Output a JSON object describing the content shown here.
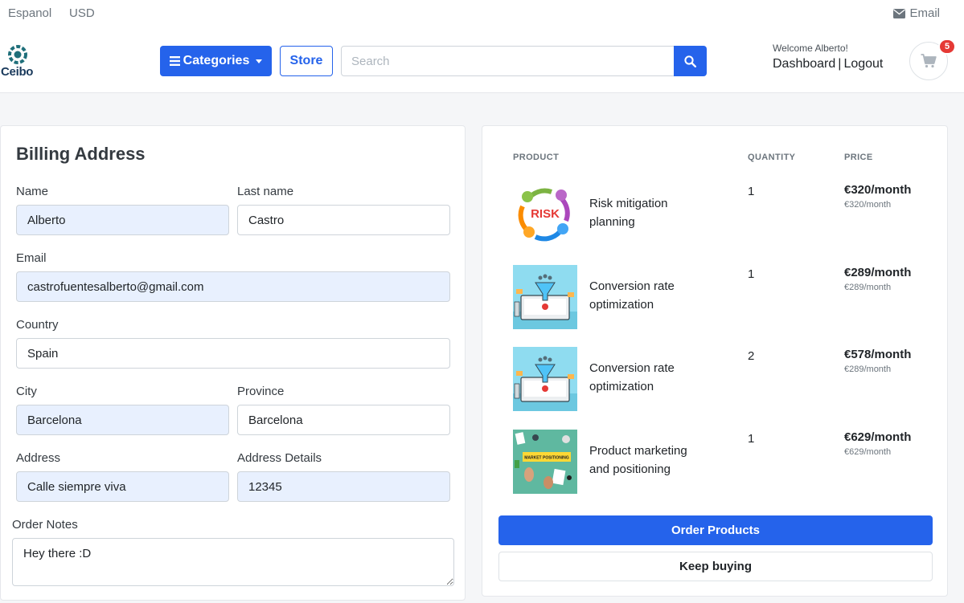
{
  "topbar": {
    "language": "Espanol",
    "currency": "USD",
    "email_label": "Email"
  },
  "header": {
    "logo_text": "Ceibo",
    "categories_label": "Categories",
    "store_label": "Store",
    "search_placeholder": "Search",
    "welcome": "Welcome Alberto!",
    "dashboard_label": "Dashboard",
    "separator": "|",
    "logout_label": "Logout",
    "cart_count": "5"
  },
  "billing": {
    "title": "Billing Address",
    "name_label": "Name",
    "name_value": "Alberto",
    "lastname_label": "Last name",
    "lastname_value": "Castro",
    "email_label": "Email",
    "email_value": "castrofuentesalberto@gmail.com",
    "country_label": "Country",
    "country_value": "Spain",
    "city_label": "City",
    "city_value": "Barcelona",
    "province_label": "Province",
    "province_value": "Barcelona",
    "address_label": "Address",
    "address_value": "Calle siempre viva",
    "address_details_label": "Address Details",
    "address_details_value": "12345",
    "notes_label": "Order Notes",
    "notes_value": "Hey there :D"
  },
  "order": {
    "col_product": "PRODUCT",
    "col_quantity": "QUANTITY",
    "col_price": "PRICE",
    "items": [
      {
        "name": "Risk mitigation planning",
        "quantity": "1",
        "total": "€320/month",
        "unit": "€320/month",
        "image": "risk-image"
      },
      {
        "name": "Conversion rate optimization",
        "quantity": "1",
        "total": "€289/month",
        "unit": "€289/month",
        "image": "conversion-image"
      },
      {
        "name": "Conversion rate optimization",
        "quantity": "2",
        "total": "€578/month",
        "unit": "€289/month",
        "image": "conversion-image"
      },
      {
        "name": "Product marketing and positioning",
        "quantity": "1",
        "total": "€629/month",
        "unit": "€629/month",
        "image": "marketing-image"
      }
    ],
    "order_button": "Order Products",
    "keep_button": "Keep buying"
  },
  "image_text": {
    "risk_word": "RISK",
    "market_banner": "MARKET POSITIONING"
  },
  "colors": {
    "primary": "#2563eb",
    "badge": "#e53935"
  }
}
